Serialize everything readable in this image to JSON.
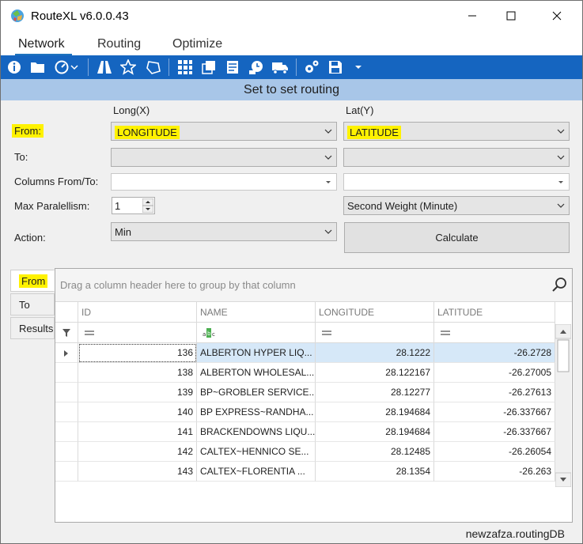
{
  "window": {
    "title": "RouteXL v6.0.0.43"
  },
  "menu": {
    "items": [
      "Network",
      "Routing",
      "Optimize"
    ]
  },
  "toolbar": {
    "icons": [
      "info-icon",
      "folder-icon",
      "gauge-icon",
      "dropdown-arrow-icon",
      "road-icon",
      "star-icon",
      "polygon-icon",
      "grid-icon",
      "network-icon",
      "document-icon",
      "clock-icon",
      "truck-icon",
      "gears-icon",
      "save-icon",
      "dropdown-arrow-icon"
    ]
  },
  "header": {
    "text": "Set to set routing"
  },
  "form": {
    "long_label": "Long(X)",
    "lat_label": "Lat(Y)",
    "from_label": "From:",
    "to_label": "To:",
    "columns_label": "Columns From/To:",
    "max_par_label": "Max Paralellism:",
    "action_label": "Action:",
    "from_long": "LONGITUDE",
    "from_lat": "LATITUDE",
    "to_long": "",
    "to_lat": "",
    "columns_long": "",
    "columns_lat": "",
    "max_par_value": "1",
    "weight_value": "Second Weight (Minute)",
    "action_value": "Min",
    "calculate_label": "Calculate"
  },
  "tabs": [
    "From",
    "To",
    "Results"
  ],
  "grid": {
    "group_hint": "Drag a column header here to group by that column",
    "columns": [
      "ID",
      "NAME",
      "LONGITUDE",
      "LATITUDE"
    ],
    "rows": [
      [
        "136",
        "ALBERTON HYPER LIQ...",
        "28.1222",
        "-26.2728"
      ],
      [
        "138",
        "ALBERTON WHOLESAL...",
        "28.122167",
        "-26.27005"
      ],
      [
        "139",
        "BP~GROBLER SERVICE...",
        "28.12277",
        "-26.27613"
      ],
      [
        "140",
        "BP EXPRESS~RANDHA...",
        "28.194684",
        "-26.337667"
      ],
      [
        "141",
        "BRACKENDOWNS LIQU...",
        "28.194684",
        "-26.337667"
      ],
      [
        "142",
        "CALTEX~HENNICO SE...",
        "28.12485",
        "-26.26054"
      ],
      [
        "143",
        "CALTEX~FLORENTIA ...",
        "28.1354",
        "-26.263"
      ]
    ]
  },
  "status": {
    "text": "newzafza.routingDB"
  },
  "colors": {
    "toolbar": "#1565c0",
    "header": "#a8c6e8",
    "highlight": "#fff200",
    "selection": "#d6e8f8"
  }
}
